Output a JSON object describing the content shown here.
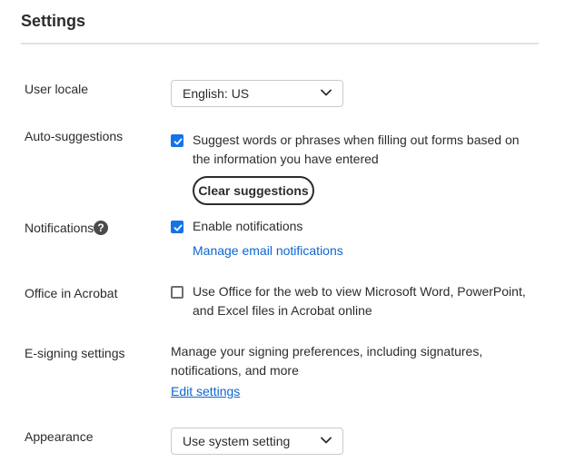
{
  "header": {
    "title": "Settings"
  },
  "user_locale": {
    "label": "User locale",
    "selected": "English: US",
    "icon": "chevron-down-icon"
  },
  "auto_suggestions": {
    "label": "Auto-suggestions",
    "checked": true,
    "line1": "Suggest words or phrases when filling out forms based on",
    "line2": "the information you have entered",
    "clear_button": "Clear suggestions"
  },
  "notifications": {
    "label": "Notifications",
    "help_icon": "?",
    "checked": true,
    "checkbox_label": "Enable notifications",
    "manage_link": "Manage email notifications"
  },
  "office_in_acrobat": {
    "label": "Office in Acrobat",
    "checked": false,
    "line1": "Use Office for the web to view Microsoft Word, PowerPoint,",
    "line2": "and Excel files in Acrobat online"
  },
  "e_signing": {
    "label": "E-signing settings",
    "line1": "Manage your signing preferences, including signatures,",
    "line2": "notifications, and more",
    "edit_link": "Edit settings"
  },
  "appearance": {
    "label": "Appearance",
    "selected": "Use system setting",
    "icon": "chevron-down-icon"
  },
  "colors": {
    "accent": "#1473e6",
    "link": "#0d66d0",
    "text": "#2c2c2c",
    "divider": "#e1e1e1"
  }
}
